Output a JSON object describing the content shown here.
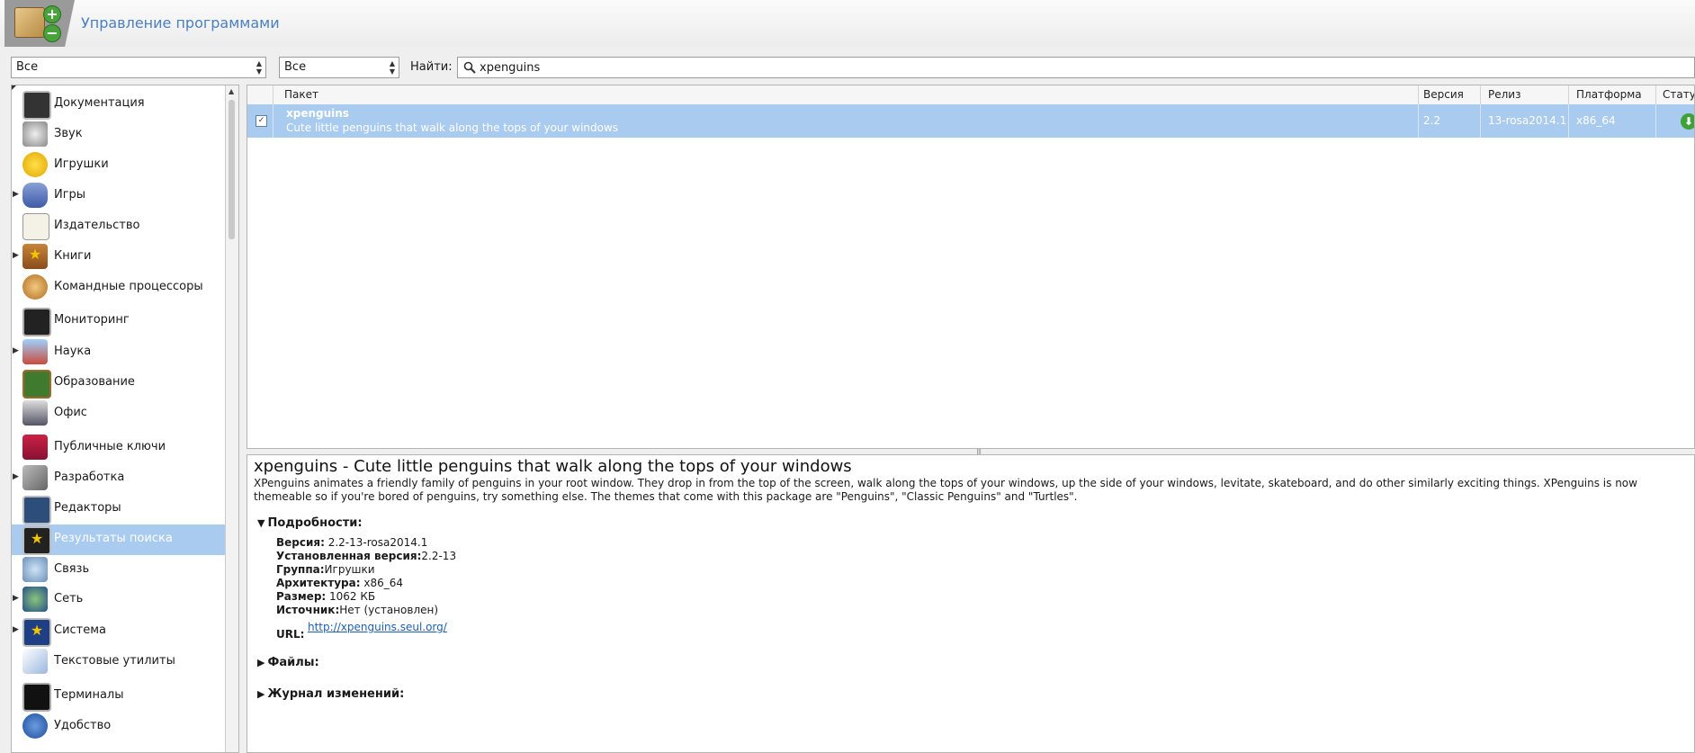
{
  "header": {
    "title": "Управление программами"
  },
  "toolbar": {
    "filter1": "Все",
    "filter2": "Все",
    "find_label": "Найти:",
    "search_value": "xpenguins"
  },
  "sidebar": {
    "items": [
      {
        "label": "Документация",
        "expandable": false,
        "icon": "documentation-icon"
      },
      {
        "label": "Звук",
        "expandable": false,
        "icon": "speaker-icon"
      },
      {
        "label": "Игрушки",
        "expandable": false,
        "icon": "smiley-icon"
      },
      {
        "label": "Игры",
        "expandable": true,
        "icon": "gamepad-icon"
      },
      {
        "label": "Издательство",
        "expandable": false,
        "icon": "publishing-icon"
      },
      {
        "label": "Книги",
        "expandable": true,
        "icon": "book-icon"
      },
      {
        "label": "Командные процессоры",
        "expandable": false,
        "icon": "shell-icon"
      },
      {
        "label": "Мониторинг",
        "expandable": false,
        "icon": "monitor-icon"
      },
      {
        "label": "Наука",
        "expandable": true,
        "icon": "science-icon"
      },
      {
        "label": "Образование",
        "expandable": false,
        "icon": "chalkboard-icon"
      },
      {
        "label": "Офис",
        "expandable": false,
        "icon": "office-icon"
      },
      {
        "label": "Публичные ключи",
        "expandable": false,
        "icon": "keys-icon"
      },
      {
        "label": "Разработка",
        "expandable": true,
        "icon": "tools-icon"
      },
      {
        "label": "Редакторы",
        "expandable": false,
        "icon": "editor-icon"
      },
      {
        "label": "Результаты поиска",
        "expandable": false,
        "icon": "star-icon",
        "selected": true
      },
      {
        "label": "Связь",
        "expandable": false,
        "icon": "communication-icon"
      },
      {
        "label": "Сеть",
        "expandable": true,
        "icon": "network-icon"
      },
      {
        "label": "Система",
        "expandable": true,
        "icon": "system-icon"
      },
      {
        "label": "Текстовые утилиты",
        "expandable": false,
        "icon": "text-tools-icon"
      },
      {
        "label": "Терминалы",
        "expandable": false,
        "icon": "terminal-icon"
      },
      {
        "label": "Удобство",
        "expandable": false,
        "icon": "accessibility-icon"
      }
    ]
  },
  "table": {
    "headers": {
      "package": "Пакет",
      "version": "Версия",
      "release": "Релиз",
      "platform": "Платформа",
      "status": "Статус"
    },
    "rows": [
      {
        "checked": true,
        "name": "xpenguins",
        "summary": "Cute little penguins that walk along the tops of your windows",
        "version": "2.2",
        "release": "13-rosa2014.1",
        "platform": "x86_64",
        "status_icon": "download-icon"
      }
    ]
  },
  "details": {
    "title": "xpenguins - Cute little penguins that walk along the tops of your windows",
    "description": "XPenguins animates a friendly family of penguins in your root window. They drop in from the top of the screen, walk along the tops of your windows, up the side of your windows, levitate, skateboard, and do other similarly exciting things. XPenguins is now themeable so if you're bored of penguins, try something else. The themes that come with this package are \"Penguins\", \"Classic Penguins\" and \"Turtles\".",
    "details_label": "Подробности:",
    "fields": [
      {
        "key": "Версия:",
        "value": " 2.2-13-rosa2014.1"
      },
      {
        "key": "Установленная версия:",
        "value": "2.2-13"
      },
      {
        "key": "Группа:",
        "value": "Игрушки"
      },
      {
        "key": "Архитектура:",
        "value": " x86_64"
      },
      {
        "key": "Размер:",
        "value": " 1062 КБ"
      },
      {
        "key": "Источник:",
        "value": "Нет (установлен)"
      }
    ],
    "url_label": "URL:",
    "url": "http://xpenguins.seul.org/",
    "files_label": "Файлы:",
    "changelog_label": "Журнал изменений:"
  },
  "colors": {
    "selection": "#a9cbef",
    "title_blue": "#4a7fc0",
    "link": "#1c5fb5"
  }
}
